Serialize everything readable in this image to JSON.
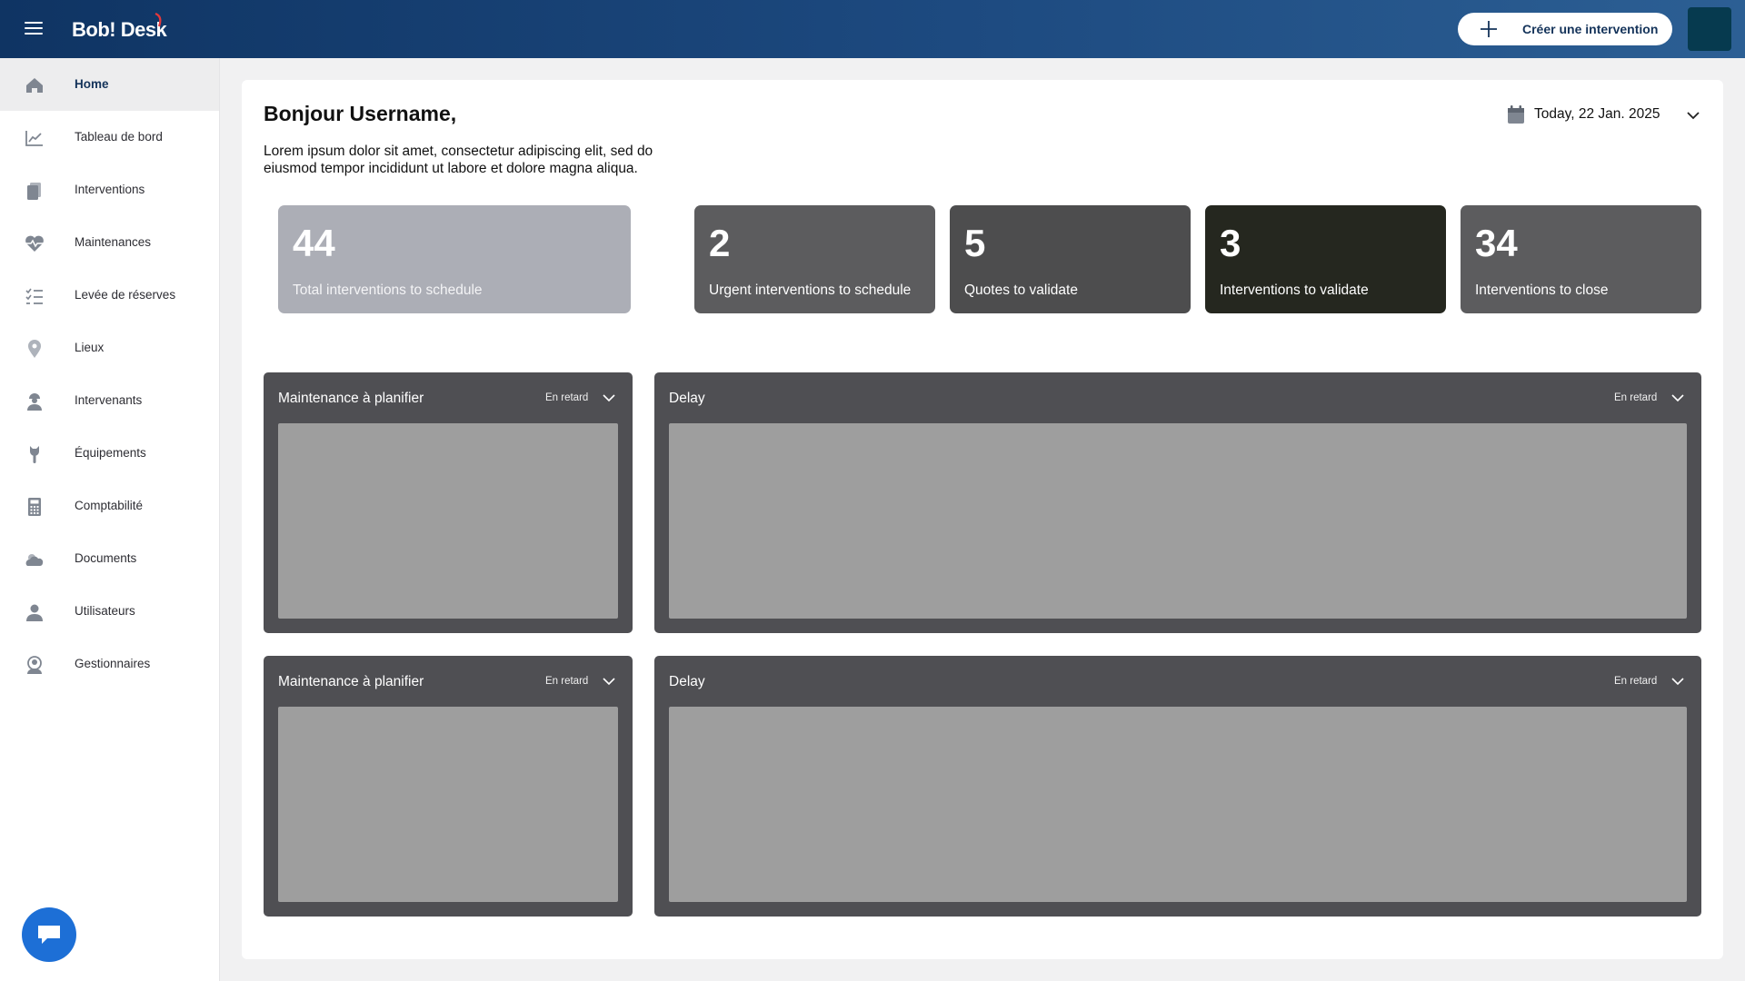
{
  "header": {
    "logo_text": "Bob! Desk",
    "create_button_label": "Créer une intervention",
    "menu_icon": "hamburger-icon",
    "brand_color": "#0f3463"
  },
  "sidebar": {
    "items": [
      {
        "label": "Home",
        "icon": "home-icon",
        "active": true
      },
      {
        "label": "Tableau de bord",
        "icon": "chart-line-icon"
      },
      {
        "label": "Interventions",
        "icon": "documents-icon"
      },
      {
        "label": "Maintenances",
        "icon": "heartbeat-icon"
      },
      {
        "label": "Levée de réserves",
        "icon": "checklist-icon"
      },
      {
        "label": "Lieux",
        "icon": "location-pin-icon"
      },
      {
        "label": "Intervenants",
        "icon": "worker-icon"
      },
      {
        "label": "Équipements",
        "icon": "wrench-icon"
      },
      {
        "label": "Comptabilité",
        "icon": "calculator-icon"
      },
      {
        "label": "Documents",
        "icon": "cloud-folder-icon"
      },
      {
        "label": "Utilisateurs",
        "icon": "user-icon"
      },
      {
        "label": "Gestionnaires",
        "icon": "manager-icon"
      }
    ],
    "chat_icon": "chat-icon",
    "chat_color": "#1d6fd6"
  },
  "main": {
    "greeting": "Bonjour Username,",
    "intro": "Lorem ipsum dolor sit amet, consectetur adipiscing elit, sed do eiusmod tempor incididunt ut labore et dolore magna aliqua.",
    "date_label": "Today, 22 Jan. 2025",
    "stats": [
      {
        "value": "44",
        "label": "Total interventions to schedule",
        "color": "#acaeb6"
      },
      {
        "value": "2",
        "label": "Urgent interventions to schedule",
        "color": "#5c5c5e"
      },
      {
        "value": "5",
        "label": "Quotes to validate",
        "color": "#4d4d4e"
      },
      {
        "value": "3",
        "label": "Interventions to validate",
        "color": "#25271f"
      },
      {
        "value": "34",
        "label": "Interventions to close",
        "color": "#5c5c5e"
      }
    ],
    "panels": [
      {
        "title": "Maintenance à planifier",
        "filter": "En retard"
      },
      {
        "title": "Delay",
        "filter": "En retard"
      },
      {
        "title": "Maintenance à planifier",
        "filter": "En retard"
      },
      {
        "title": "Delay",
        "filter": "En retard"
      }
    ]
  }
}
